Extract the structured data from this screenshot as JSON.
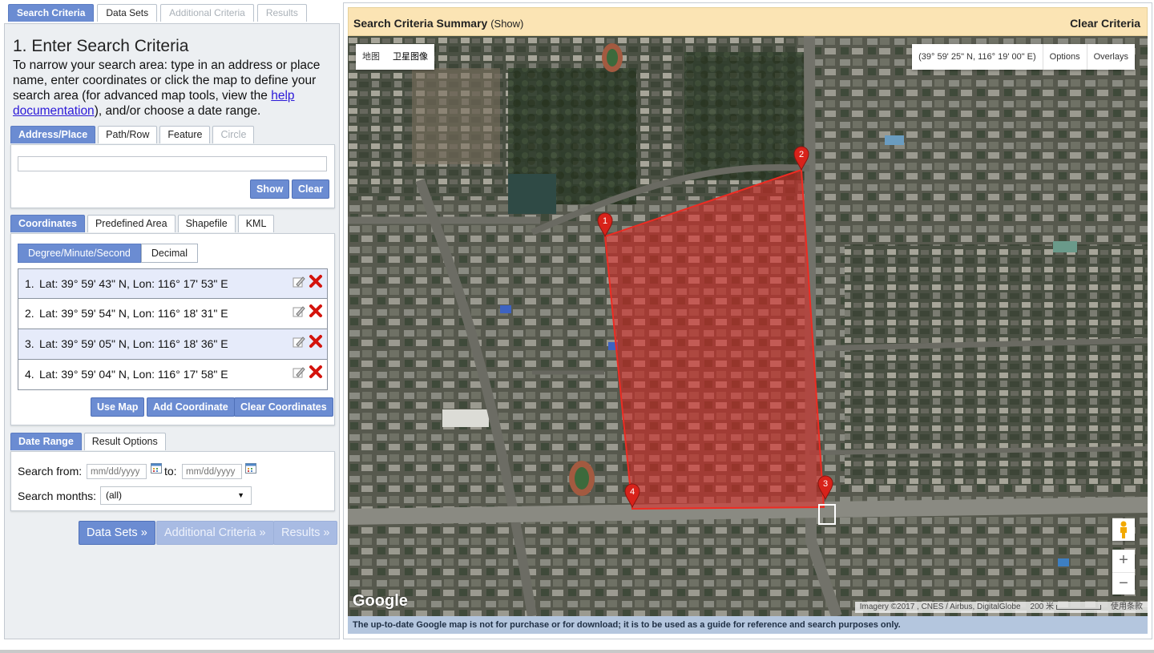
{
  "top_tabs": [
    {
      "label": "Search Criteria",
      "state": "active"
    },
    {
      "label": "Data Sets",
      "state": "normal"
    },
    {
      "label": "Additional Criteria",
      "state": "disabled"
    },
    {
      "label": "Results",
      "state": "disabled"
    }
  ],
  "step": {
    "title": "1. Enter Search Criteria",
    "intro_before": "To narrow your search area: type in an address or place name, enter coordinates or click the map to define your search area (for advanced map tools, view the ",
    "intro_link": "help documentation",
    "intro_after": "), and/or choose a date range."
  },
  "area_tabs": [
    {
      "label": "Address/Place",
      "state": "active"
    },
    {
      "label": "Path/Row",
      "state": "normal"
    },
    {
      "label": "Feature",
      "state": "normal"
    },
    {
      "label": "Circle",
      "state": "disabled"
    }
  ],
  "address": {
    "value": "",
    "show_label": "Show",
    "clear_label": "Clear"
  },
  "coord_tabs": [
    {
      "label": "Coordinates",
      "state": "active"
    },
    {
      "label": "Predefined Area",
      "state": "normal"
    },
    {
      "label": "Shapefile",
      "state": "normal"
    },
    {
      "label": "KML",
      "state": "normal"
    }
  ],
  "format_toggle": {
    "dms": "Degree/Minute/Second",
    "decimal": "Decimal",
    "selected": "dms"
  },
  "coordinates": [
    {
      "index": "1.",
      "text": "Lat: 39° 59' 43\" N, Lon: 116° 17' 53\" E"
    },
    {
      "index": "2.",
      "text": "Lat: 39° 59' 54\" N, Lon: 116° 18' 31\" E"
    },
    {
      "index": "3.",
      "text": "Lat: 39° 59' 05\" N, Lon: 116° 18' 36\" E"
    },
    {
      "index": "4.",
      "text": "Lat: 39° 59' 04\" N, Lon: 116° 17' 58\" E"
    }
  ],
  "coord_buttons": {
    "use_map": "Use Map",
    "add": "Add Coordinate",
    "clear": "Clear Coordinates"
  },
  "date_tabs": [
    {
      "label": "Date Range",
      "state": "active"
    },
    {
      "label": "Result Options",
      "state": "normal"
    }
  ],
  "date_range": {
    "from_label": "Search from:",
    "from_placeholder": "mm/dd/yyyy",
    "to_label": "to:",
    "to_placeholder": "mm/dd/yyyy",
    "months_label": "Search months:",
    "months_value": "(all)"
  },
  "nav_buttons": [
    {
      "label": "Data Sets »",
      "state": "enabled"
    },
    {
      "label": "Additional Criteria »",
      "state": "disabled"
    },
    {
      "label": "Results »",
      "state": "disabled"
    }
  ],
  "summary": {
    "title": "Search Criteria Summary",
    "show": "(Show)",
    "clear": "Clear Criteria"
  },
  "map": {
    "type_map": "地图",
    "type_satellite": "卫星图像",
    "selected_type": "satellite",
    "cursor_coords": "(39° 59' 25\" N, 116° 19' 00\" E)",
    "options": "Options",
    "overlays": "Overlays",
    "logo": "Google",
    "attribution": "Imagery ©2017 , CNES / Airbus, DigitalGlobe",
    "scale": "200 米",
    "terms": "使用条款",
    "zoom_in": "+",
    "zoom_out": "−",
    "polygon_color": "#e8231e",
    "markers": [
      "1",
      "2",
      "3",
      "4"
    ]
  },
  "disclaimer": "The up-to-date Google map is not for purchase or for download; it is to be used as a guide for reference and search purposes only."
}
